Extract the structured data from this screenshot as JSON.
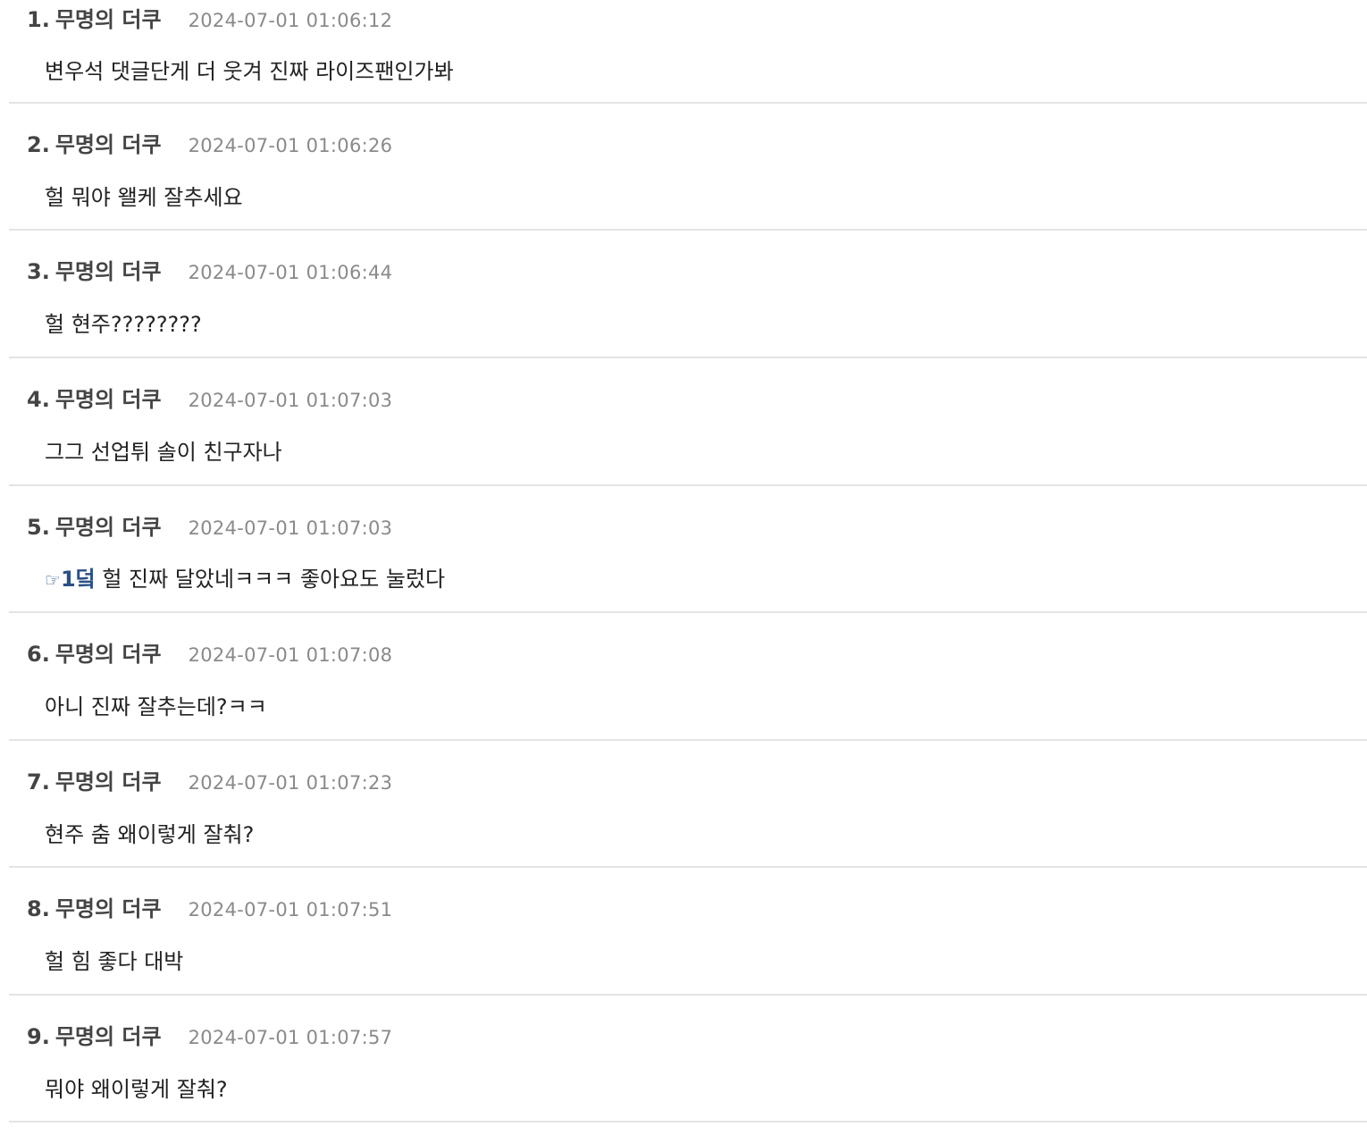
{
  "comments": [
    {
      "number": "1.",
      "author": "무명의 더쿠",
      "time": "2024-07-01 01:06:12",
      "body": "변우석 댓글단게 더 웃겨 진짜 라이즈팬인가봐"
    },
    {
      "number": "2.",
      "author": "무명의 더쿠",
      "time": "2024-07-01 01:06:26",
      "body": "헐 뭐야 왤케 잘추세요"
    },
    {
      "number": "3.",
      "author": "무명의 더쿠",
      "time": "2024-07-01 01:06:44",
      "body": "헐 현주????????"
    },
    {
      "number": "4.",
      "author": "무명의 더쿠",
      "time": "2024-07-01 01:07:03",
      "body": "그그 선업튀 솔이 친구자나"
    },
    {
      "number": "5.",
      "author": "무명의 더쿠",
      "time": "2024-07-01 01:07:03",
      "reply_icon": "☞",
      "reply_ref": "1덬",
      "body": " 헐 진짜 달았네ㅋㅋㅋ 좋아요도 눌렀다"
    },
    {
      "number": "6.",
      "author": "무명의 더쿠",
      "time": "2024-07-01 01:07:08",
      "body": "아니 진짜 잘추는데?ㅋㅋ"
    },
    {
      "number": "7.",
      "author": "무명의 더쿠",
      "time": "2024-07-01 01:07:23",
      "body": "현주 춤 왜이렇게 잘춰?"
    },
    {
      "number": "8.",
      "author": "무명의 더쿠",
      "time": "2024-07-01 01:07:51",
      "body": "헐 힘 좋다 대박"
    },
    {
      "number": "9.",
      "author": "무명의 더쿠",
      "time": "2024-07-01 01:07:57",
      "body": "뭐야 왜이렇게 잘춰?"
    }
  ],
  "colors": {
    "author": "#444444",
    "time": "#8a8a8a",
    "body": "#222222",
    "reply_ref": "#2b4f86",
    "divider": "#e4e4e4"
  }
}
